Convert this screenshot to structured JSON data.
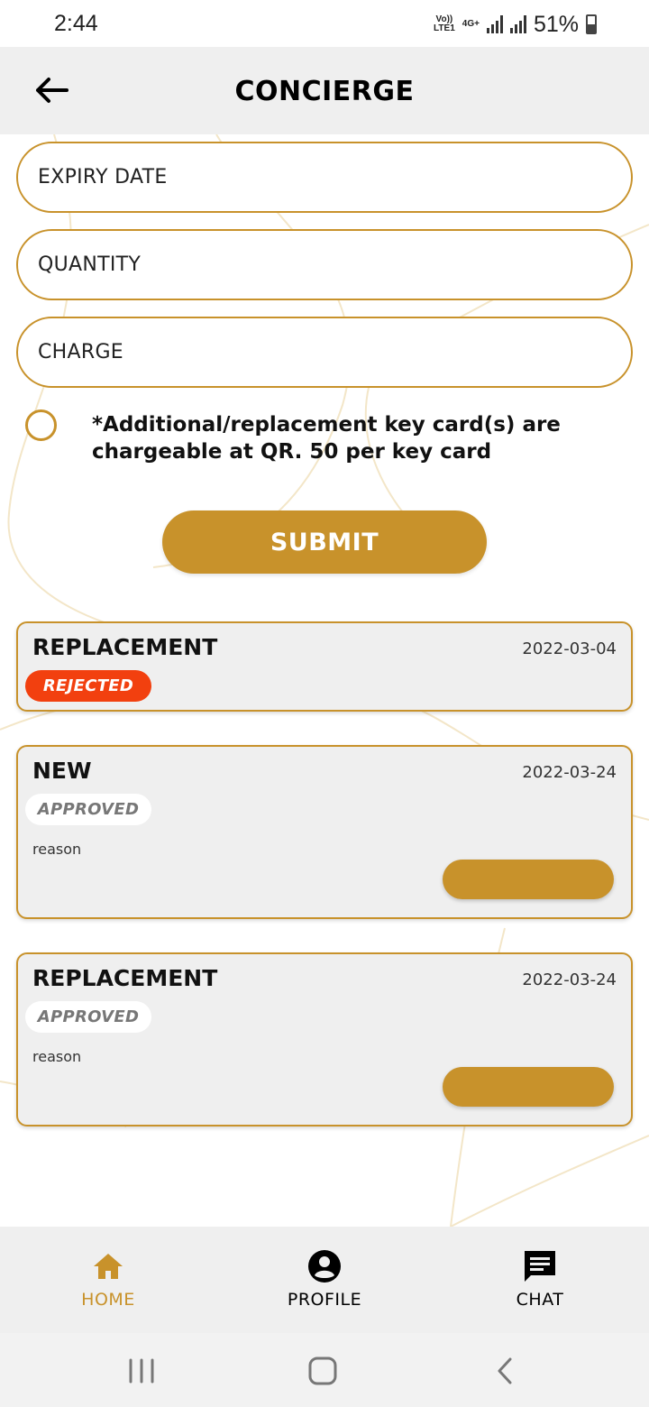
{
  "status_bar": {
    "time": "2:44",
    "network_top": "Vo))",
    "network_bottom": "LTE1",
    "network_type": "4G+",
    "battery": "51%"
  },
  "header": {
    "title": "CONCIERGE",
    "back_icon": "arrow-left-icon"
  },
  "form": {
    "expiry_date_placeholder": "EXPIRY DATE",
    "quantity_placeholder": "QUANTITY",
    "charge_placeholder": "CHARGE",
    "notice": "*Additional/replacement key card(s) are chargeable at QR. 50 per key card",
    "submit_label": "SUBMIT"
  },
  "requests": [
    {
      "type": "REPLACEMENT",
      "date": "2022-03-04",
      "status": "REJECTED"
    },
    {
      "type": "NEW",
      "date": "2022-03-24",
      "status": "APPROVED",
      "reason": "reason"
    },
    {
      "type": "REPLACEMENT",
      "date": "2022-03-24",
      "status": "APPROVED",
      "reason": "reason"
    }
  ],
  "bottom_nav": {
    "items": [
      {
        "label": "HOME",
        "icon": "home-icon",
        "active": true
      },
      {
        "label": "PROFILE",
        "icon": "profile-icon",
        "active": false
      },
      {
        "label": "CHAT",
        "icon": "chat-icon",
        "active": false
      }
    ]
  },
  "colors": {
    "accent": "#c8922b",
    "rejected": "#f2400f",
    "header_bg": "#efefef",
    "card_bg": "#efefef"
  }
}
